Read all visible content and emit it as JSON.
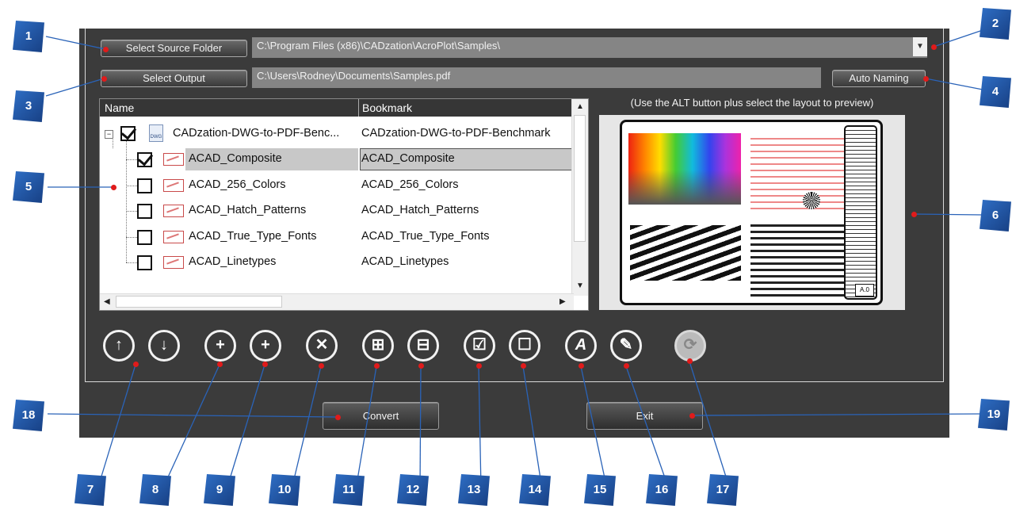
{
  "buttons": {
    "select_source": "Select Source Folder",
    "select_output": "Select Output",
    "auto_naming": "Auto Naming",
    "convert": "Convert",
    "exit": "Exit"
  },
  "fields": {
    "source_path": "C:\\Program Files (x86)\\CADzation\\AcroPlot\\Samples\\",
    "output_path": "C:\\Users\\Rodney\\Documents\\Samples.pdf"
  },
  "tree": {
    "col_name": "Name",
    "col_bookmark": "Bookmark",
    "root": {
      "name": "CADzation-DWG-to-PDF-Benc...",
      "bookmark": "CADzation-DWG-to-PDF-Benchmark",
      "checked": true
    },
    "items": [
      {
        "name": "ACAD_Composite",
        "bookmark": "ACAD_Composite",
        "checked": true
      },
      {
        "name": "ACAD_256_Colors",
        "bookmark": "ACAD_256_Colors",
        "checked": false
      },
      {
        "name": "ACAD_Hatch_Patterns",
        "bookmark": "ACAD_Hatch_Patterns",
        "checked": false
      },
      {
        "name": "ACAD_True_Type_Fonts",
        "bookmark": "ACAD_True_Type_Fonts",
        "checked": false
      },
      {
        "name": "ACAD_Linetypes",
        "bookmark": "ACAD_Linetypes",
        "checked": false
      }
    ],
    "dwg_icon_label": "DWG"
  },
  "preview": {
    "hint": "(Use the ALT button plus select the layout to preview)",
    "sheet_tag": "A.0"
  },
  "toolbar": [
    {
      "name": "move-up-icon",
      "glyph": "↑"
    },
    {
      "name": "move-down-icon",
      "glyph": "↓"
    },
    {
      "name": "add-folder-icon",
      "glyph": "+"
    },
    {
      "name": "add-file-icon",
      "glyph": "+"
    },
    {
      "name": "remove-icon",
      "glyph": "✕"
    },
    {
      "name": "expand-all-icon",
      "glyph": "⊞"
    },
    {
      "name": "collapse-all-icon",
      "glyph": "⊟"
    },
    {
      "name": "check-all-icon",
      "glyph": "☑"
    },
    {
      "name": "uncheck-all-icon",
      "glyph": "☐"
    },
    {
      "name": "fonts-icon",
      "glyph": "A"
    },
    {
      "name": "bookmark-icon",
      "glyph": "✎"
    },
    {
      "name": "folder-refresh-icon",
      "glyph": "⟳"
    }
  ],
  "callouts": [
    "1",
    "2",
    "3",
    "4",
    "5",
    "6",
    "7",
    "8",
    "9",
    "10",
    "11",
    "12",
    "13",
    "14",
    "15",
    "16",
    "17",
    "18",
    "19"
  ],
  "colors": {
    "panel": "#3b3b3b",
    "callout": "#2f6fc6",
    "callout_dot": "#e01b1b",
    "selected_row": "#c8c8c8"
  }
}
